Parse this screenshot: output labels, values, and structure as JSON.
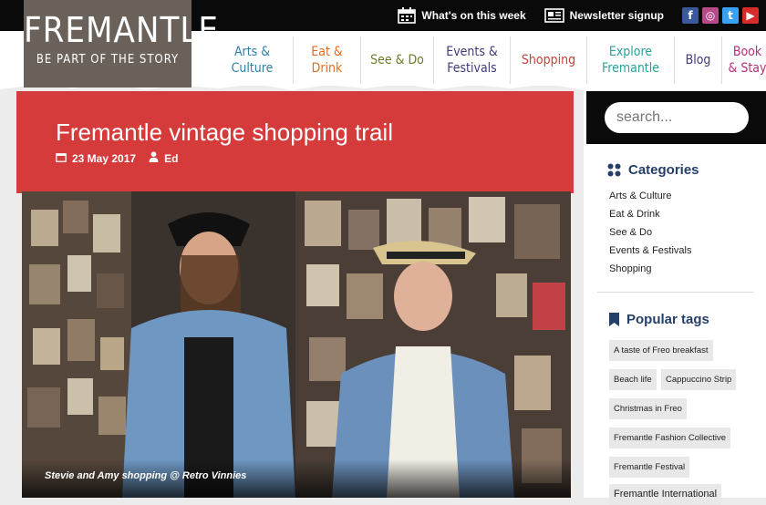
{
  "top_links": {
    "whats_on": "What's on this week",
    "newsletter": "Newsletter signup"
  },
  "social": [
    {
      "icon": "facebook-icon",
      "glyph": "f",
      "color": "#3b5998"
    },
    {
      "icon": "instagram-icon",
      "glyph": "◎",
      "color": "#b84a8a"
    },
    {
      "icon": "twitter-icon",
      "glyph": "t",
      "color": "#38a1f3"
    },
    {
      "icon": "youtube-icon",
      "glyph": "▶",
      "color": "#d92b2b"
    }
  ],
  "logo": {
    "title": "FREMANTLE",
    "tagline": "BE PART OF THE STORY"
  },
  "nav": [
    {
      "label": "Arts &\nCulture",
      "color": "#2f7fa8",
      "width": 90
    },
    {
      "label": "Eat &\nDrink",
      "color": "#e06c1f",
      "width": 74
    },
    {
      "label": "See & Do",
      "color": "#6f7d2a",
      "width": 80
    },
    {
      "label": "Events &\nFestivals",
      "color": "#3f3b7d",
      "width": 84
    },
    {
      "label": "Shopping",
      "color": "#cc3d3d",
      "width": 84
    },
    {
      "label": "Explore\nFremantle",
      "color": "#2aa19a",
      "width": 96
    },
    {
      "label": "Blog",
      "color": "#3f3b7d",
      "width": 52
    },
    {
      "label": "Book\n& Stay",
      "color": "#b4307a",
      "width": 56
    }
  ],
  "post": {
    "title": "Fremantle vintage shopping trail",
    "date": "23 May 2017",
    "author": "Ed",
    "caption": "Stevie and Amy shopping @ Retro Vinnies"
  },
  "search": {
    "placeholder": "search..."
  },
  "categories": {
    "heading": "Categories",
    "items": [
      "Arts & Culture",
      "Eat & Drink",
      "See & Do",
      "Events & Festivals",
      "Shopping"
    ]
  },
  "tags": {
    "heading": "Popular tags",
    "items": [
      "A taste of Freo breakfast",
      "Beach life",
      "Cappuccino Strip",
      "Christmas in Freo",
      "Fremantle Fashion Collective",
      "Fremantle Festival",
      "Fremantle International"
    ]
  }
}
